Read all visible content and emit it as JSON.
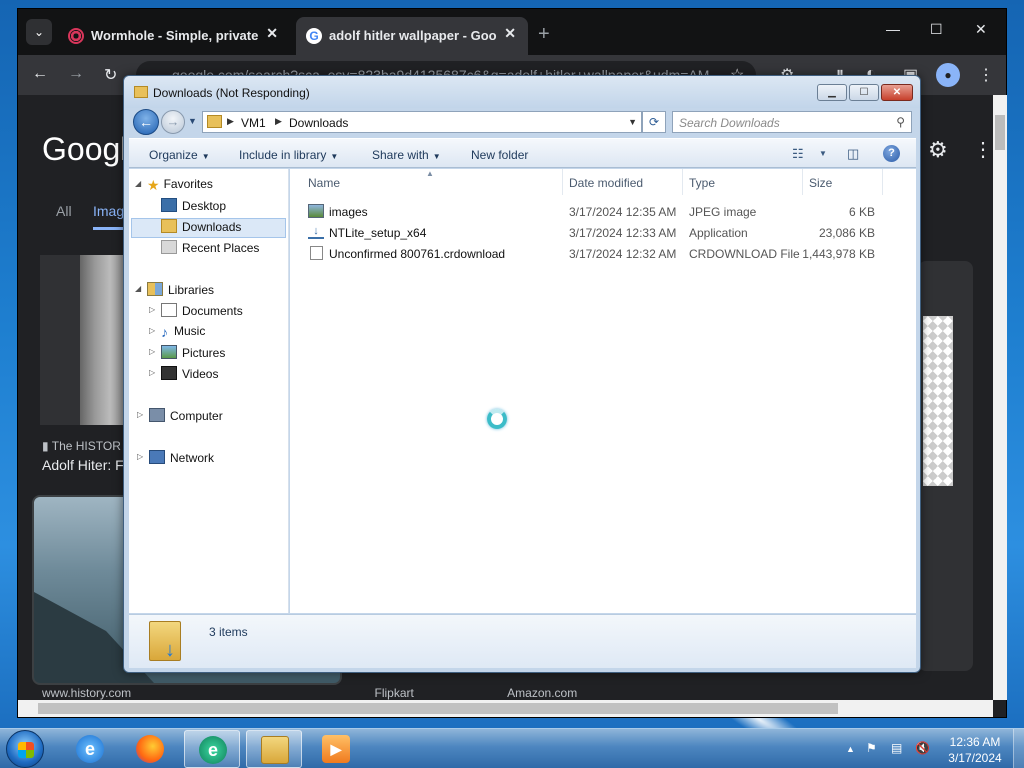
{
  "browser": {
    "tabs": [
      {
        "title": "Wormhole - Simple, private file",
        "close": "✕"
      },
      {
        "title": "adolf hitler wallpaper - Google",
        "close": "✕"
      }
    ],
    "new_tab": "+",
    "omnibox_text": "google.com/search?sca_esv=823ba9d4125687c6&q=adolf+hitler+wallpaper&udm=AM",
    "google": {
      "logo": "Googl",
      "tabs": [
        "All",
        "Imag"
      ],
      "result_source": "The HISTOR",
      "result_title": "Adolf Hiter: F",
      "bottom_links": [
        "www.history.com",
        "Flipkart",
        "Amazon.com"
      ]
    }
  },
  "explorer": {
    "title": "Downloads (Not Responding)",
    "breadcrumb": [
      "VM1",
      "Downloads"
    ],
    "search_placeholder": "Search Downloads",
    "commands": [
      {
        "label": "Organize"
      },
      {
        "label": "Include in library"
      },
      {
        "label": "Share with"
      },
      {
        "label": "New folder"
      }
    ],
    "nav": {
      "favorites": "Favorites",
      "desktop": "Desktop",
      "downloads": "Downloads",
      "recent": "Recent Places",
      "libraries": "Libraries",
      "documents": "Documents",
      "music": "Music",
      "pictures": "Pictures",
      "videos": "Videos",
      "computer": "Computer",
      "network": "Network"
    },
    "columns": [
      "Name",
      "Date modified",
      "Type",
      "Size"
    ],
    "files": [
      {
        "name": "images",
        "date": "3/17/2024 12:35 AM",
        "type": "JPEG image",
        "size": "6 KB",
        "icon": "jpeg-icon"
      },
      {
        "name": "NTLite_setup_x64",
        "date": "3/17/2024 12:33 AM",
        "type": "Application",
        "size": "23,086 KB",
        "icon": "application-icon"
      },
      {
        "name": "Unconfirmed 800761.crdownload",
        "date": "3/17/2024 12:32 AM",
        "type": "CRDOWNLOAD File",
        "size": "1,443,978 KB",
        "icon": "file-icon"
      }
    ],
    "status_count": "3 items"
  },
  "taskbar": {
    "time": "12:36 AM",
    "date": "3/17/2024"
  }
}
